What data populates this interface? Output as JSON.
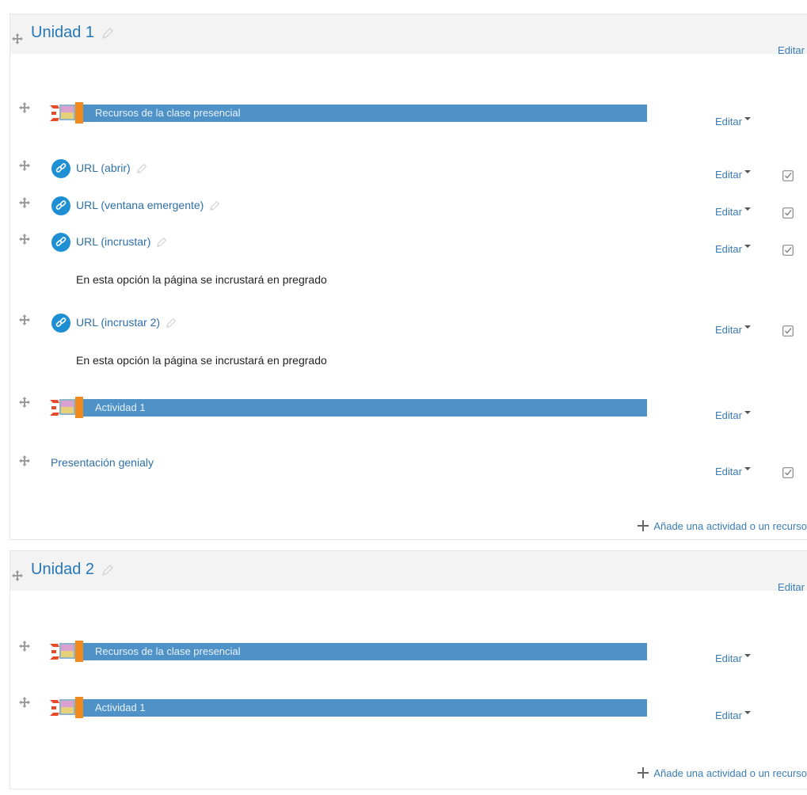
{
  "sections": [
    {
      "title": "Unidad 1",
      "edit_label": "Editar",
      "rows": [
        {
          "kind": "banner",
          "label": "Recursos de la clase presencial",
          "edit": "Editar"
        },
        {
          "kind": "url",
          "label": "URL (abrir)",
          "edit": "Editar"
        },
        {
          "kind": "url",
          "label": "URL (ventana emergente)",
          "edit": "Editar"
        },
        {
          "kind": "url",
          "label": "URL (incrustar)",
          "edit": "Editar",
          "description": "En esta opción la página se incrustará en pregrado"
        },
        {
          "kind": "url",
          "label": "URL (incrustar 2)",
          "edit": "Editar",
          "description": "En esta opción la página se incrustará en pregrado"
        },
        {
          "kind": "banner",
          "label": "Actividad 1",
          "edit": "Editar"
        },
        {
          "kind": "link",
          "label": "Presentación genialy",
          "edit": "Editar"
        }
      ],
      "add_label": "Añade una actividad o un recurso"
    },
    {
      "title": "Unidad 2",
      "edit_label": "Editar",
      "rows": [
        {
          "kind": "banner",
          "label": "Recursos de la clase presencial",
          "edit": "Editar"
        },
        {
          "kind": "banner",
          "label": "Actividad 1",
          "edit": "Editar"
        }
      ],
      "add_label": "Añade una actividad o un recurso"
    }
  ],
  "icons": {
    "move": "move-icon",
    "edit_title": "pencil-icon",
    "url": "link-icon",
    "banner": "label-banner-icon",
    "completion": "completion-checkbox-icon",
    "add": "plus-icon"
  },
  "colors": {
    "link": "#2578b9",
    "banner": "#4f92c8",
    "header_bg": "#f3f3f3"
  }
}
